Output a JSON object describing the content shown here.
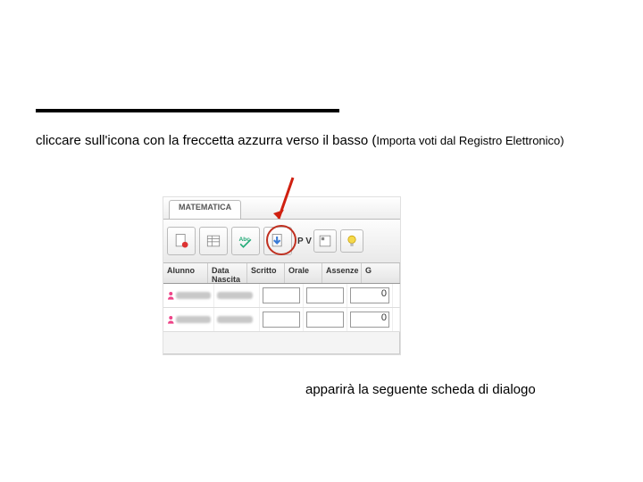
{
  "instruction": {
    "main": "cliccare sull'icona con la freccetta azzurra verso il basso (",
    "paren": "Importa voti dal Registro Elettronico)"
  },
  "screenshot": {
    "tab_label": "MATEMATICA",
    "toolbar": {
      "pv_label": "P V",
      "icons": {
        "btn1": "page-red-dot",
        "btn2": "table-grid",
        "btn3": "abc-spellcheck",
        "btn4": "import-arrow-down",
        "btn5": "periodic",
        "btn6": "lightbulb"
      }
    },
    "cols": {
      "alunno": "Alunno",
      "data": "Data Nascita",
      "scritto": "Scritto",
      "orale": "Orale",
      "assenze": "Assenze",
      "rest": "G"
    },
    "rows": [
      {
        "assenze": "0"
      },
      {
        "assenze": "0"
      }
    ]
  },
  "footer_text": "apparirà la seguente scheda di dialogo"
}
